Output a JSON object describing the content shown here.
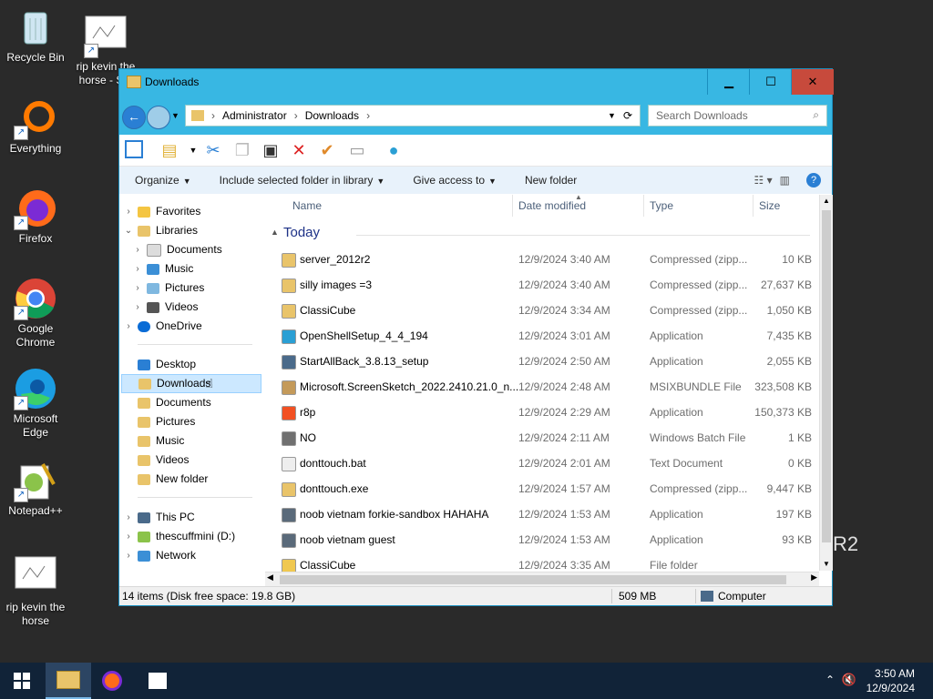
{
  "desktop": {
    "icons": [
      {
        "label": "Recycle Bin"
      },
      {
        "label": "rip kevin the horse - S..."
      },
      {
        "label": "Everything"
      },
      {
        "label": "Firefox"
      },
      {
        "label": "Google Chrome"
      },
      {
        "label": "Microsoft Edge"
      },
      {
        "label": "Notepad++"
      },
      {
        "label": "rip kevin the horse"
      }
    ],
    "watermark": "R2"
  },
  "window": {
    "title": "Downloads",
    "address": {
      "crumbs": [
        "Administrator",
        "Downloads"
      ]
    },
    "search_placeholder": "Search Downloads",
    "menu": {
      "organize": "Organize",
      "include": "Include selected folder in library",
      "share": "Give access to",
      "new_folder": "New folder"
    },
    "nav": {
      "favorites": "Favorites",
      "libraries": "Libraries",
      "lib_documents": "Documents",
      "lib_music": "Music",
      "lib_pictures": "Pictures",
      "lib_videos": "Videos",
      "onedrive": "OneDrive",
      "desktop": "Desktop",
      "downloads": "Downloads",
      "documents": "Documents",
      "pictures": "Pictures",
      "music": "Music",
      "videos": "Videos",
      "new_folder": "New folder",
      "this_pc": "This PC",
      "drive_d": "thescuffmini (D:)",
      "network": "Network"
    },
    "columns": {
      "name": "Name",
      "date": "Date modified",
      "type": "Type",
      "size": "Size"
    },
    "group": "Today",
    "files": [
      {
        "name": "server_2012r2",
        "date": "12/9/2024 3:40 AM",
        "type": "Compressed (zipp...",
        "size": "10 KB",
        "icon": "zip-folder-icon"
      },
      {
        "name": "silly images =3",
        "date": "12/9/2024 3:40 AM",
        "type": "Compressed (zipp...",
        "size": "27,637 KB",
        "icon": "zip-folder-icon"
      },
      {
        "name": "ClassiCube",
        "date": "12/9/2024 3:34 AM",
        "type": "Compressed (zipp...",
        "size": "1,050 KB",
        "icon": "zip-folder-icon"
      },
      {
        "name": "OpenShellSetup_4_4_194",
        "date": "12/9/2024 3:01 AM",
        "type": "Application",
        "size": "7,435 KB",
        "icon": "shell-icon"
      },
      {
        "name": "StartAllBack_3.8.13_setup",
        "date": "12/9/2024 2:50 AM",
        "type": "Application",
        "size": "2,055 KB",
        "icon": "installer-icon"
      },
      {
        "name": "Microsoft.ScreenSketch_2022.2410.21.0_n...",
        "date": "12/9/2024 2:48 AM",
        "type": "MSIXBUNDLE File",
        "size": "323,508 KB",
        "icon": "package-icon"
      },
      {
        "name": "r8p",
        "date": "12/9/2024 2:29 AM",
        "type": "Application",
        "size": "150,373 KB",
        "icon": "windows-app-icon"
      },
      {
        "name": "NO",
        "date": "12/9/2024 2:11 AM",
        "type": "Windows Batch File",
        "size": "1 KB",
        "icon": "batch-icon"
      },
      {
        "name": "donttouch.bat",
        "date": "12/9/2024 2:01 AM",
        "type": "Text Document",
        "size": "0 KB",
        "icon": "text-file-icon"
      },
      {
        "name": "donttouch.exe",
        "date": "12/9/2024 1:57 AM",
        "type": "Compressed (zipp...",
        "size": "9,447 KB",
        "icon": "zip-folder-icon"
      },
      {
        "name": "noob vietnam forkie-sandbox HAHAHA",
        "date": "12/9/2024 1:53 AM",
        "type": "Application",
        "size": "197 KB",
        "icon": "app-icon"
      },
      {
        "name": "noob vietnam guest",
        "date": "12/9/2024 1:53 AM",
        "type": "Application",
        "size": "93 KB",
        "icon": "app-icon"
      },
      {
        "name": "ClassiCube",
        "date": "12/9/2024 3:35 AM",
        "type": "File folder",
        "size": "",
        "icon": "folder-icon"
      }
    ],
    "status": {
      "items": "14 items (Disk free space: 19.8 GB)",
      "size": "509 MB",
      "location": "Computer"
    }
  },
  "taskbar": {
    "time": "3:50 AM",
    "date": "12/9/2024"
  },
  "colors": {
    "titlebar": "#38b7e3",
    "close": "#c74a3c",
    "taskbar": "#112338",
    "accent": "#0078d7"
  }
}
